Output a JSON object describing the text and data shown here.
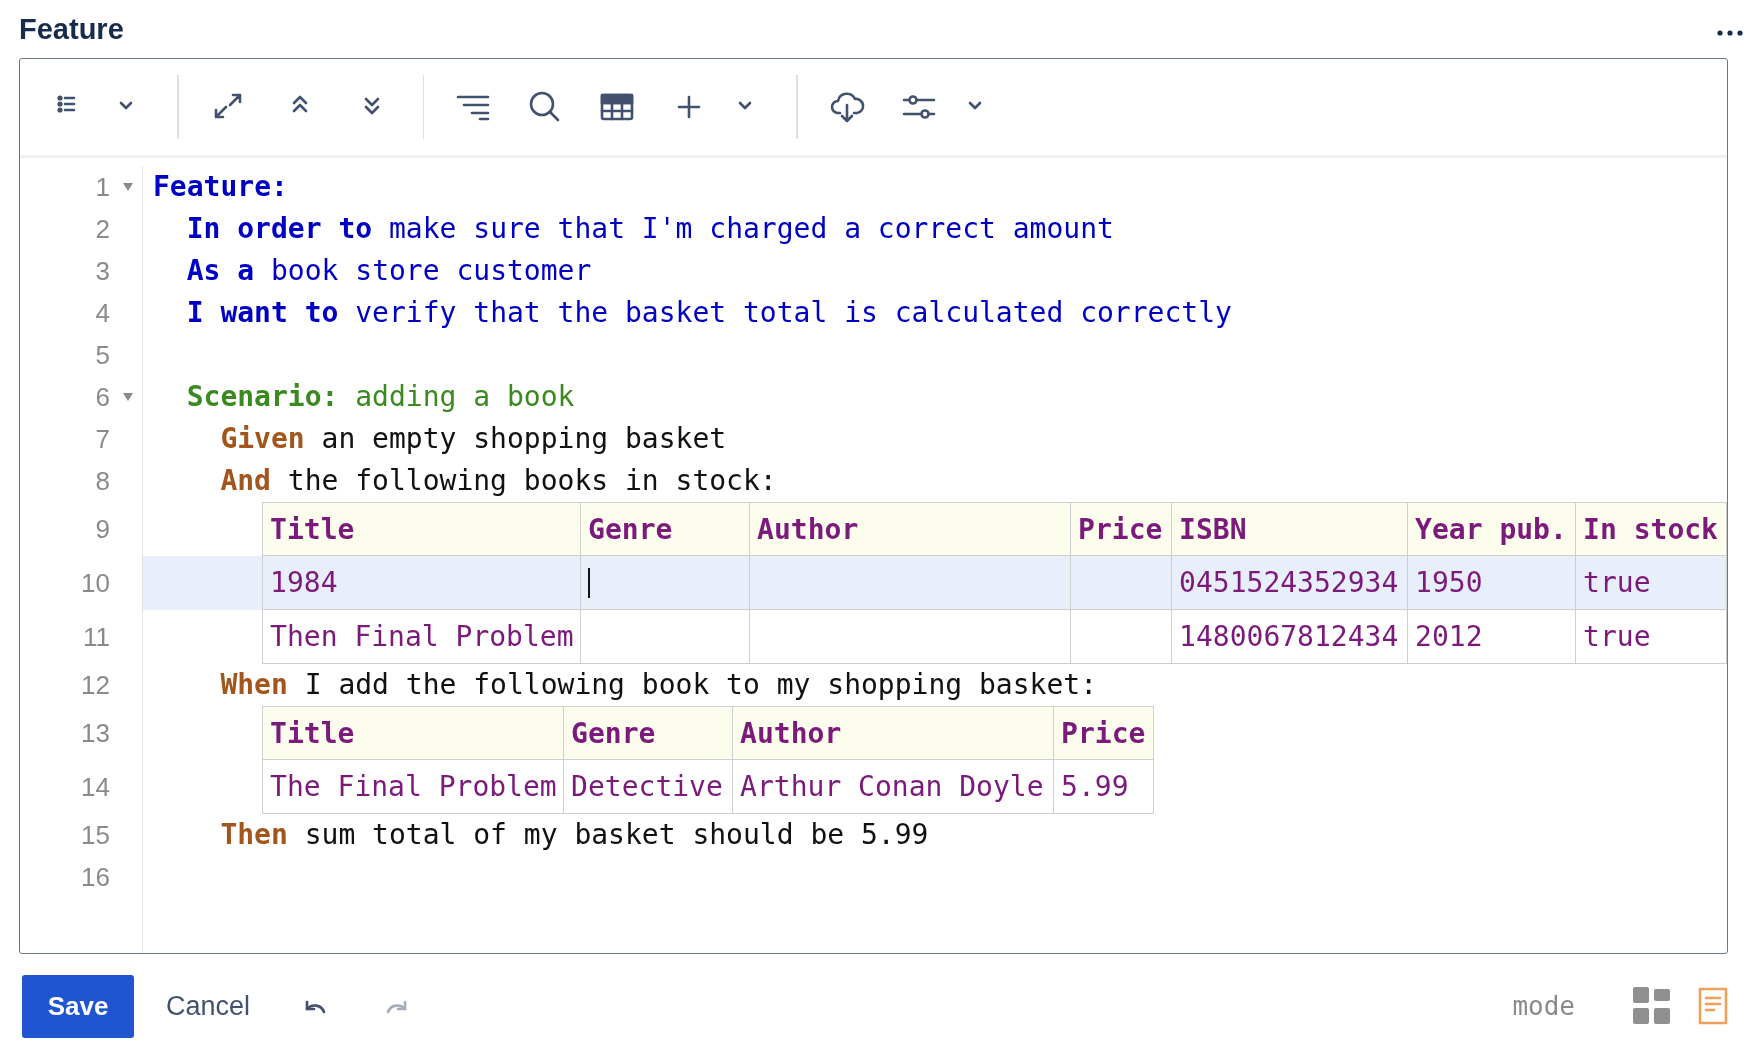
{
  "title": "Feature",
  "editor": {
    "lines": [
      {
        "number": "1",
        "kind": "feature",
        "expanded": true,
        "tokens": [
          {
            "kind": "keyword",
            "text": "Feature:"
          }
        ],
        "children": [
          {
            "number": "2",
            "kind": "feature",
            "tokens": [
              {
                "kind": "keyword",
                "text": "In order to"
              },
              {
                "kind": "text",
                "text": "make sure that I'm charged a correct amount"
              }
            ]
          },
          {
            "number": "3",
            "kind": "feature",
            "tokens": [
              {
                "kind": "keyword",
                "text": "As a"
              },
              {
                "kind": "text",
                "text": "book store customer"
              }
            ]
          },
          {
            "number": "4",
            "kind": "feature",
            "tokens": [
              {
                "kind": "keyword",
                "text": "I want to"
              },
              {
                "kind": "text",
                "text": "verify that the basket total is calculated correctly"
              }
            ]
          },
          {
            "number": "5",
            "kind": "blank"
          },
          {
            "number": "6",
            "kind": "scenario",
            "expanded": true,
            "tokens": [
              {
                "kind": "keyword",
                "text": "Scenario:"
              },
              {
                "kind": "text",
                "text": "adding a book"
              }
            ],
            "children": [
              {
                "number": "7",
                "kind": "step",
                "tokens": [
                  {
                    "kind": "keyword",
                    "text": "Given"
                  },
                  {
                    "kind": "text",
                    "text": "an empty shopping basket"
                  }
                ]
              },
              {
                "number": "8",
                "kind": "step",
                "tokens": [
                  {
                    "kind": "keyword",
                    "text": "And"
                  },
                  {
                    "kind": "text",
                    "text": "the following books in stock:"
                  }
                ],
                "table": {
                  "header": {
                    "number": "9",
                    "cells": [
                      "Title",
                      "Genre",
                      "Author",
                      "Price",
                      "ISBN",
                      "Year pub.",
                      "In stock"
                    ]
                  },
                  "rows": [
                    {
                      "number": "10",
                      "selected": true,
                      "cells": [
                        {
                          "text": "1984",
                          "caret": false
                        },
                        {
                          "caret": true
                        },
                        {
                          "caret": false
                        },
                        {
                          "caret": false
                        },
                        {
                          "text": "0451524352934",
                          "caret": false
                        },
                        {
                          "text": "1950",
                          "caret": false
                        },
                        {
                          "text": "true",
                          "caret": false
                        }
                      ]
                    },
                    {
                      "number": "11",
                      "selected": false,
                      "cells": [
                        {
                          "text": "Then Final Problem",
                          "caret": false
                        },
                        {
                          "caret": false
                        },
                        {
                          "caret": false
                        },
                        {
                          "caret": false
                        },
                        {
                          "text": "1480067812434",
                          "caret": false
                        },
                        {
                          "text": "2012",
                          "caret": false
                        },
                        {
                          "text": "true",
                          "caret": false
                        }
                      ]
                    }
                  ]
                }
              },
              {
                "number": "12",
                "kind": "step",
                "tokens": [
                  {
                    "kind": "keyword",
                    "text": "When"
                  },
                  {
                    "kind": "text",
                    "text": "I add the following book to my shopping basket:"
                  }
                ],
                "table": {
                  "header": {
                    "number": "13",
                    "cells": [
                      "Title",
                      "Genre",
                      "Author",
                      "Price"
                    ]
                  },
                  "rows": [
                    {
                      "number": "14",
                      "selected": false,
                      "cells": [
                        {
                          "text": "The Final Problem",
                          "caret": false
                        },
                        {
                          "text": "Detective",
                          "caret": false
                        },
                        {
                          "text": "Arthur Conan Doyle",
                          "caret": false
                        },
                        {
                          "text": "5.99",
                          "caret": false
                        }
                      ]
                    }
                  ]
                }
              },
              {
                "number": "15",
                "kind": "step",
                "tokens": [
                  {
                    "kind": "keyword",
                    "text": "Then"
                  },
                  {
                    "kind": "text",
                    "text": "sum total of my basket should be 5.99"
                  }
                ]
              }
            ]
          }
        ]
      },
      {
        "number": "16",
        "kind": "blank"
      }
    ]
  },
  "footer": {
    "save": "Save",
    "cancel": "Cancel",
    "history": [
      {
        "kind": "undo",
        "disabled": false
      },
      {
        "kind": "redo",
        "disabled": true
      }
    ],
    "mode_label": "mode",
    "modes": [
      {
        "kind": "grid",
        "selected": false
      },
      {
        "kind": "document",
        "selected": true
      }
    ]
  }
}
